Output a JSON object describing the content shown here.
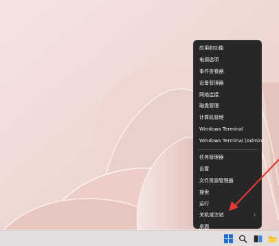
{
  "context_menu": {
    "items": [
      {
        "label": "应用和功能"
      },
      {
        "label": "电源选项"
      },
      {
        "label": "事件查看器"
      },
      {
        "label": "设备管理器"
      },
      {
        "label": "网络连接"
      },
      {
        "label": "磁盘管理"
      },
      {
        "label": "计算机管理"
      },
      {
        "label": "Windows Terminal"
      },
      {
        "label": "Windows Terminal (Admin)"
      },
      {
        "label": "任务管理器"
      },
      {
        "label": "设置"
      },
      {
        "label": "文件资源管理器"
      },
      {
        "label": "搜索"
      },
      {
        "label": "运行"
      },
      {
        "label": "关机或注销",
        "submenu_indicator": "›"
      },
      {
        "label": "桌面"
      }
    ]
  },
  "taskbar": {
    "icons": [
      "windows-start-icon",
      "search-icon",
      "task-view-icon",
      "file-explorer-icon"
    ]
  },
  "colors": {
    "menu_bg": "#272727",
    "annotation_arrow": "#e53935",
    "wallpaper": "#f1dcd8"
  }
}
